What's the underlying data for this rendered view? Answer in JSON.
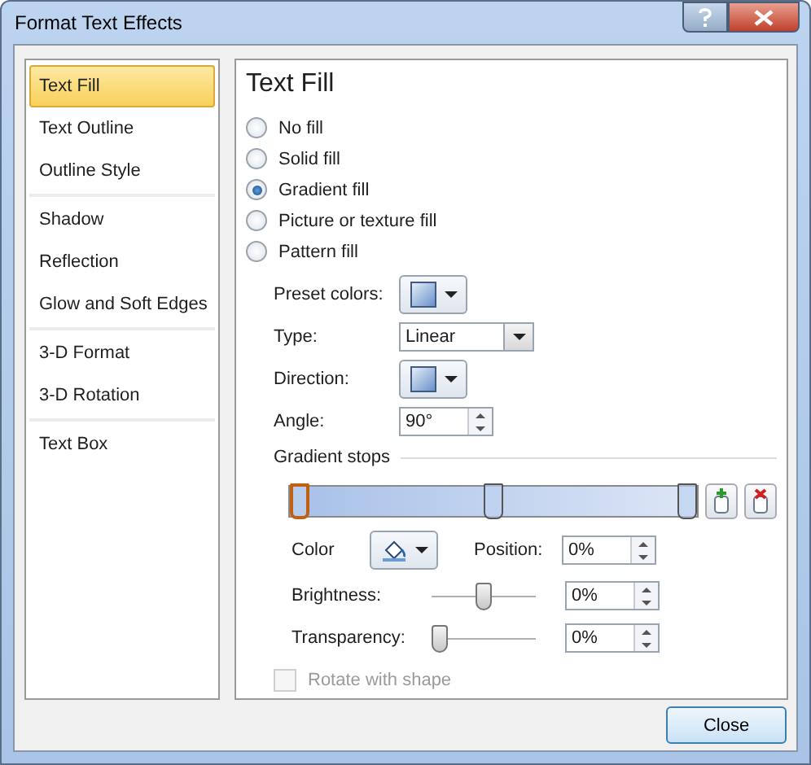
{
  "window": {
    "title": "Format Text Effects"
  },
  "sidebar": {
    "groups": [
      {
        "items": [
          {
            "label": "Text Fill",
            "selected": true
          },
          {
            "label": "Text Outline",
            "selected": false
          },
          {
            "label": "Outline Style",
            "selected": false
          }
        ]
      },
      {
        "items": [
          {
            "label": "Shadow",
            "selected": false
          },
          {
            "label": "Reflection",
            "selected": false
          },
          {
            "label": "Glow and Soft Edges",
            "selected": false
          }
        ]
      },
      {
        "items": [
          {
            "label": "3-D Format",
            "selected": false
          },
          {
            "label": "3-D Rotation",
            "selected": false
          }
        ]
      },
      {
        "items": [
          {
            "label": "Text Box",
            "selected": false
          }
        ]
      }
    ]
  },
  "panel": {
    "heading": "Text Fill",
    "fill_options": [
      {
        "label": "No fill",
        "selected": false
      },
      {
        "label": "Solid fill",
        "selected": false
      },
      {
        "label": "Gradient fill",
        "selected": true
      },
      {
        "label": "Picture or texture fill",
        "selected": false
      },
      {
        "label": "Pattern fill",
        "selected": false
      }
    ],
    "settings": [
      {
        "kind": "swatch",
        "label": "Preset colors:"
      },
      {
        "kind": "combo",
        "label": "Type:",
        "value": "Linear"
      },
      {
        "kind": "swatch",
        "label": "Direction:"
      },
      {
        "kind": "spin",
        "label": "Angle:",
        "value": "90°"
      }
    ],
    "gradient_stops": {
      "label": "Gradient stops",
      "stops": [
        {
          "level": 0,
          "selected": true
        },
        {
          "level": 0.5,
          "selected": false
        },
        {
          "level": 1,
          "selected": false
        }
      ]
    },
    "color_label": "Color",
    "position": {
      "label": "Position:",
      "value": "0%"
    },
    "sliders": [
      {
        "label": "Brightness:",
        "level": 0.5,
        "value": "0%"
      },
      {
        "label": "Transparency:",
        "level": 0,
        "value": "0%"
      }
    ],
    "rotate_with_shape": {
      "label": "Rotate with shape",
      "checked": false,
      "disabled": true
    }
  },
  "buttons": [
    "Close"
  ]
}
